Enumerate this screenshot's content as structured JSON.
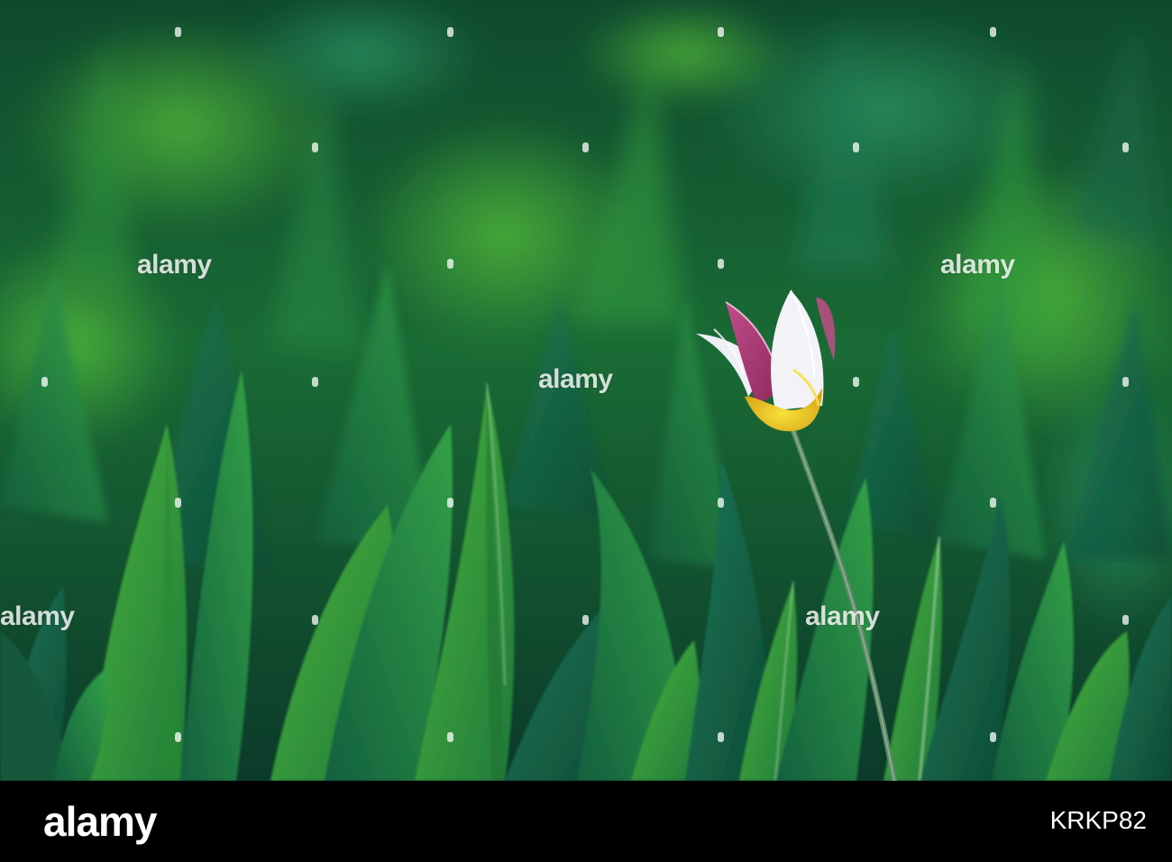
{
  "image": {
    "subject": "tulip-field",
    "colors": {
      "background_dark": "#0b3a2a",
      "leaf_light": "#3fa83a",
      "leaf_dark": "#0e5a3c",
      "petal_white": "#f3f3f7",
      "petal_pink": "#a0306a",
      "petal_yellow": "#f0d21e"
    }
  },
  "watermark": {
    "text": "alamy"
  },
  "footer": {
    "logo": "alamy",
    "image_id": "KRKP82"
  }
}
